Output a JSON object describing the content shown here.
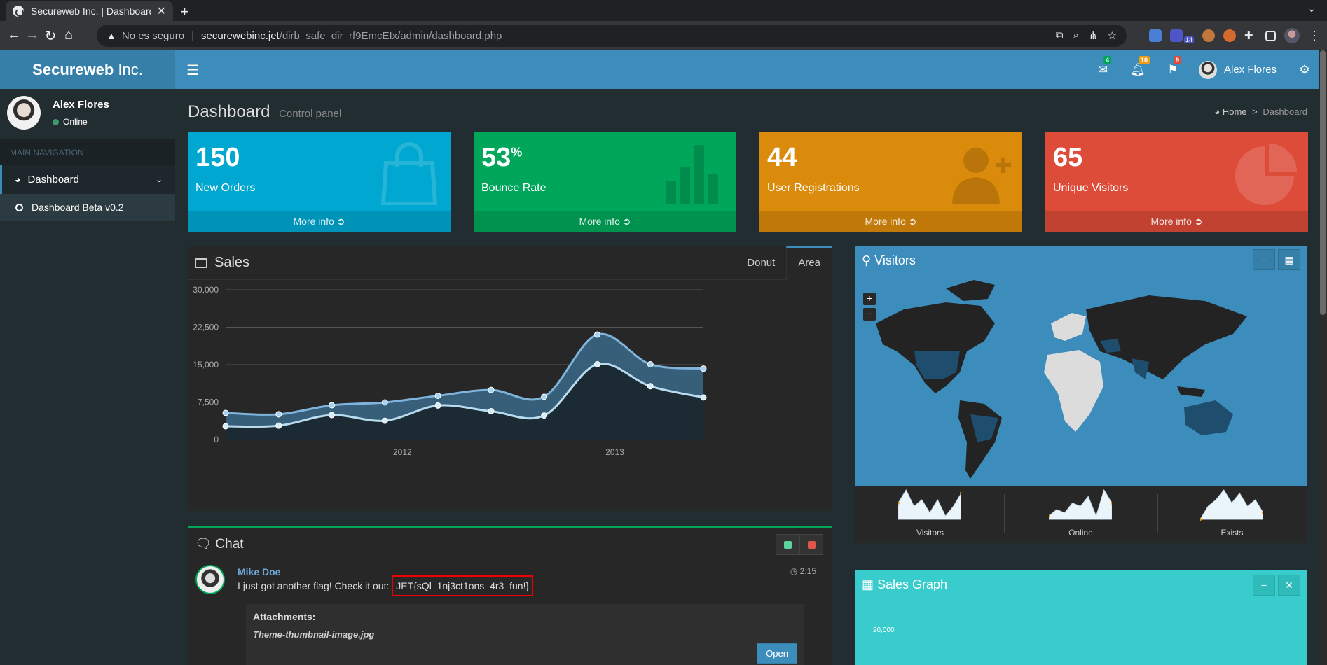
{
  "browser": {
    "tab_title": "Secureweb Inc. | Dashboard",
    "insecure_label": "No es seguro",
    "url_host": "securewebinc.jet",
    "url_path": "/dirb_safe_dir_rf9EmcEIx/admin/dashboard.php",
    "ext_badge": "14"
  },
  "header": {
    "logo_bold": "Secureweb",
    "logo_rest": "Inc.",
    "messages_count": "4",
    "notifications_count": "10",
    "tasks_count": "9",
    "user_name": "Alex Flores"
  },
  "sidebar": {
    "user_name": "Alex Flores",
    "status": "Online",
    "header": "MAIN NAVIGATION",
    "items": [
      {
        "label": "Dashboard"
      },
      {
        "label": "Dashboard Beta v0.2"
      }
    ]
  },
  "page": {
    "title": "Dashboard",
    "subtitle": "Control panel",
    "breadcrumb_home": "Home",
    "breadcrumb_sep": ">",
    "breadcrumb_current": "Dashboard"
  },
  "stats": [
    {
      "value": "150",
      "suffix": "",
      "label": "New Orders",
      "more": "More info",
      "color": "#00a7d0",
      "footer_color": "#0093b8"
    },
    {
      "value": "53",
      "suffix": "%",
      "label": "Bounce Rate",
      "more": "More info",
      "color": "#00a65a",
      "footer_color": "#00924f"
    },
    {
      "value": "44",
      "suffix": "",
      "label": "User Registrations",
      "more": "More info",
      "color": "#db8b0b",
      "footer_color": "#c17a0a"
    },
    {
      "value": "65",
      "suffix": "",
      "label": "Unique Visitors",
      "more": "More info",
      "color": "#dd4b39",
      "footer_color": "#c24232"
    }
  ],
  "sales": {
    "title": "Sales",
    "tabs": [
      "Donut",
      "Area"
    ],
    "active_tab": "Area"
  },
  "chart_data": {
    "type": "area",
    "y_ticks": [
      "30,000",
      "22,500",
      "15,000",
      "7,500",
      "0"
    ],
    "x_ticks": [
      "2012",
      "2013"
    ],
    "ylim": [
      0,
      30000
    ],
    "x": [
      "2011 Q1",
      "2011 Q2",
      "2011 Q3",
      "2011 Q4",
      "2012 Q1",
      "2012 Q2",
      "2012 Q3",
      "2012 Q4",
      "2013 Q1",
      "2013 Q2"
    ],
    "series": [
      {
        "values": [
          2666,
          2778,
          4912,
          3767,
          6810,
          5670,
          4820,
          15073,
          10687,
          8432
        ],
        "color": "#a0d0e0"
      },
      {
        "values": [
          5333,
          5056,
          6876,
          7432,
          8770,
          9928,
          8574,
          21020,
          15073,
          14210
        ],
        "color": "#3c8dbc"
      }
    ]
  },
  "chat": {
    "title": "Chat",
    "author": "Mike Doe",
    "time": "2:15",
    "message_prefix": "I just got another flag! Check it out:",
    "flag": "JET{sQl_1nj3ct1ons_4r3_fun!}",
    "attachments_label": "Attachments:",
    "file_name": "Theme-thumbnail-image.jpg",
    "open_label": "Open"
  },
  "visitors": {
    "title": "Visitors",
    "zoom_in": "+",
    "zoom_out": "−",
    "sparklines": [
      {
        "label": "Visitors",
        "values": [
          5,
          9,
          4,
          6,
          2,
          6,
          1,
          4,
          8
        ]
      },
      {
        "label": "Online",
        "values": [
          1,
          3,
          2,
          5,
          4,
          7,
          1,
          9,
          5
        ]
      },
      {
        "label": "Exists",
        "values": [
          0,
          4,
          6,
          9,
          5,
          8,
          4,
          6,
          2
        ]
      }
    ]
  },
  "sales_graph": {
    "title": "Sales Graph",
    "y_tick": "20,000"
  }
}
